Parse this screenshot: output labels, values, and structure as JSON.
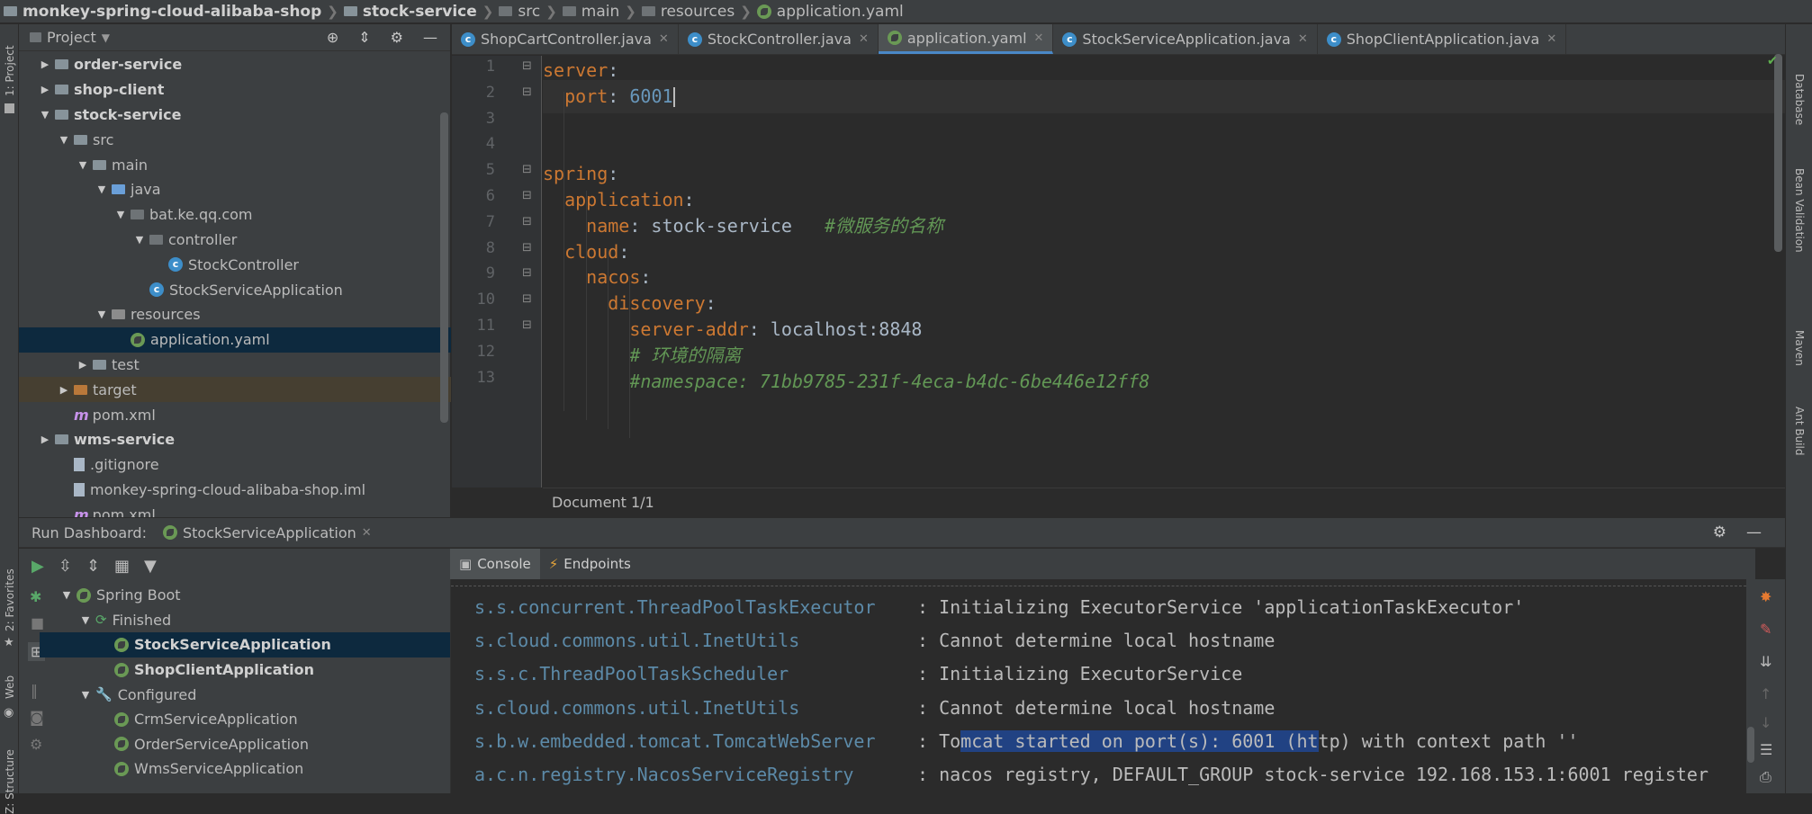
{
  "breadcrumb": [
    "monkey-spring-cloud-alibaba-shop",
    "stock-service",
    "src",
    "main",
    "resources",
    "application.yaml"
  ],
  "left_stripe": {
    "project": "1: Project",
    "favorites": "2: Favorites",
    "web": "Web",
    "structure": "Z: Structure"
  },
  "right_stripe": {
    "database": "Database",
    "bean_validation": "Bean Validation",
    "maven": "Maven",
    "ant": "Ant Build"
  },
  "project_panel": {
    "title": "Project",
    "tree": [
      {
        "label": "order-service",
        "indent": 0,
        "toggle": "collapsed",
        "icon": "module-folder",
        "bold": true
      },
      {
        "label": "shop-client",
        "indent": 0,
        "toggle": "collapsed",
        "icon": "module-folder",
        "bold": true
      },
      {
        "label": "stock-service",
        "indent": 0,
        "toggle": "expanded",
        "icon": "module-folder",
        "bold": true
      },
      {
        "label": "src",
        "indent": 1,
        "toggle": "expanded",
        "icon": "folder"
      },
      {
        "label": "main",
        "indent": 2,
        "toggle": "expanded",
        "icon": "folder"
      },
      {
        "label": "java",
        "indent": 3,
        "toggle": "expanded",
        "icon": "source-folder"
      },
      {
        "label": "bat.ke.qq.com",
        "indent": 4,
        "toggle": "expanded",
        "icon": "package"
      },
      {
        "label": "controller",
        "indent": 5,
        "toggle": "expanded",
        "icon": "package"
      },
      {
        "label": "StockController",
        "indent": 6,
        "toggle": "none",
        "icon": "class"
      },
      {
        "label": "StockServiceApplication",
        "indent": 5,
        "toggle": "none",
        "icon": "spring-class"
      },
      {
        "label": "resources",
        "indent": 3,
        "toggle": "expanded",
        "icon": "resources-folder"
      },
      {
        "label": "application.yaml",
        "indent": 4,
        "toggle": "none",
        "icon": "spring-leaf",
        "selected": true
      },
      {
        "label": "test",
        "indent": 2,
        "toggle": "collapsed",
        "icon": "folder"
      },
      {
        "label": "target",
        "indent": 1,
        "toggle": "collapsed",
        "icon": "excluded-folder",
        "highlight": true
      },
      {
        "label": "pom.xml",
        "indent": 1,
        "toggle": "none",
        "icon": "maven"
      },
      {
        "label": "wms-service",
        "indent": 0,
        "toggle": "collapsed",
        "icon": "module-folder",
        "bold": true
      },
      {
        "label": ".gitignore",
        "indent": 1,
        "toggle": "none",
        "icon": "file"
      },
      {
        "label": "monkey-spring-cloud-alibaba-shop.iml",
        "indent": 1,
        "toggle": "none",
        "icon": "file"
      },
      {
        "label": "pom.xml",
        "indent": 1,
        "toggle": "none",
        "icon": "maven"
      }
    ]
  },
  "editor_tabs": [
    {
      "label": "ShopCartController.java",
      "icon": "class",
      "active": false
    },
    {
      "label": "StockController.java",
      "icon": "class",
      "active": false
    },
    {
      "label": "application.yaml",
      "icon": "spring-leaf",
      "active": true
    },
    {
      "label": "StockServiceApplication.java",
      "icon": "spring-class",
      "active": false
    },
    {
      "label": "ShopClientApplication.java",
      "icon": "spring-class",
      "active": false
    }
  ],
  "editor": {
    "lines": [
      {
        "n": "1",
        "tokens": [
          [
            "k",
            "server"
          ],
          [
            "v",
            ":"
          ]
        ]
      },
      {
        "n": "2",
        "tokens": [
          [
            "s",
            "  "
          ],
          [
            "k",
            "port"
          ],
          [
            "v",
            ": "
          ],
          [
            "n",
            "6001"
          ]
        ],
        "current": true
      },
      {
        "n": "3",
        "tokens": []
      },
      {
        "n": "4",
        "tokens": []
      },
      {
        "n": "5",
        "tokens": [
          [
            "k",
            "spring"
          ],
          [
            "v",
            ":"
          ]
        ]
      },
      {
        "n": "6",
        "tokens": [
          [
            "s",
            "  "
          ],
          [
            "k",
            "application"
          ],
          [
            "v",
            ":"
          ]
        ]
      },
      {
        "n": "7",
        "tokens": [
          [
            "s",
            "    "
          ],
          [
            "k",
            "name"
          ],
          [
            "v",
            ": stock-service   "
          ],
          [
            "cm",
            "#微服务的名称"
          ]
        ]
      },
      {
        "n": "8",
        "tokens": [
          [
            "s",
            "  "
          ],
          [
            "k",
            "cloud"
          ],
          [
            "v",
            ":"
          ]
        ]
      },
      {
        "n": "9",
        "tokens": [
          [
            "s",
            "    "
          ],
          [
            "k",
            "nacos"
          ],
          [
            "v",
            ":"
          ]
        ]
      },
      {
        "n": "10",
        "tokens": [
          [
            "s",
            "      "
          ],
          [
            "k",
            "discovery"
          ],
          [
            "v",
            ":"
          ]
        ]
      },
      {
        "n": "11",
        "tokens": [
          [
            "s",
            "        "
          ],
          [
            "k",
            "server-addr"
          ],
          [
            "v",
            ": localhost:8848"
          ]
        ]
      },
      {
        "n": "12",
        "tokens": [
          [
            "s",
            "        "
          ],
          [
            "cm",
            "# 环境的隔离"
          ]
        ]
      },
      {
        "n": "13",
        "tokens": [
          [
            "s",
            "        "
          ],
          [
            "cm",
            "#namespace: 71bb9785-231f-4eca-b4dc-6be446e12ff8"
          ]
        ]
      }
    ],
    "status": "Document 1/1"
  },
  "run_dashboard": {
    "title": "Run Dashboard:",
    "tab": "StockServiceApplication",
    "tree": [
      {
        "label": "Spring Boot",
        "indent": 0,
        "toggle": "expanded",
        "icon": "spring-leaf"
      },
      {
        "label": "Finished",
        "indent": 1,
        "toggle": "expanded",
        "icon": "refresh"
      },
      {
        "label": "StockServiceApplication",
        "indent": 2,
        "toggle": "none",
        "icon": "spring-leaf",
        "bold": true,
        "selected": true
      },
      {
        "label": "ShopClientApplication",
        "indent": 2,
        "toggle": "none",
        "icon": "spring-leaf",
        "bold": true
      },
      {
        "label": "Configured",
        "indent": 1,
        "toggle": "expanded",
        "icon": "wrench"
      },
      {
        "label": "CrmServiceApplication",
        "indent": 2,
        "toggle": "none",
        "icon": "spring-leaf"
      },
      {
        "label": "OrderServiceApplication",
        "indent": 2,
        "toggle": "none",
        "icon": "spring-leaf"
      },
      {
        "label": "WmsServiceApplication",
        "indent": 2,
        "toggle": "none",
        "icon": "spring-leaf"
      }
    ]
  },
  "console_tabs": [
    {
      "label": "Console",
      "active": true,
      "icon": "console-icon"
    },
    {
      "label": "Endpoints",
      "active": false,
      "icon": "endpoints-icon"
    }
  ],
  "console": {
    "lines": [
      {
        "logger": "s.s.concurrent.ThreadPoolTaskExecutor",
        "message": ": Initializing ExecutorService 'applicationTaskExecutor'"
      },
      {
        "logger": "s.cloud.commons.util.InetUtils",
        "message": ": Cannot determine local hostname"
      },
      {
        "logger": "s.s.c.ThreadPoolTaskScheduler",
        "message": ": Initializing ExecutorService"
      },
      {
        "logger": "s.cloud.commons.util.InetUtils",
        "message": ": Cannot determine local hostname"
      },
      {
        "logger": "s.b.w.embedded.tomcat.TomcatWebServer",
        "message_before": ": To",
        "message_highlight": "mcat started on port(s): 6001 (ht",
        "message_after": "tp) with context path ''"
      },
      {
        "logger": "a.c.n.registry.NacosServiceRegistry",
        "message": ": nacos registry, DEFAULT_GROUP stock-service 192.168.153.1:6001 register"
      }
    ]
  }
}
